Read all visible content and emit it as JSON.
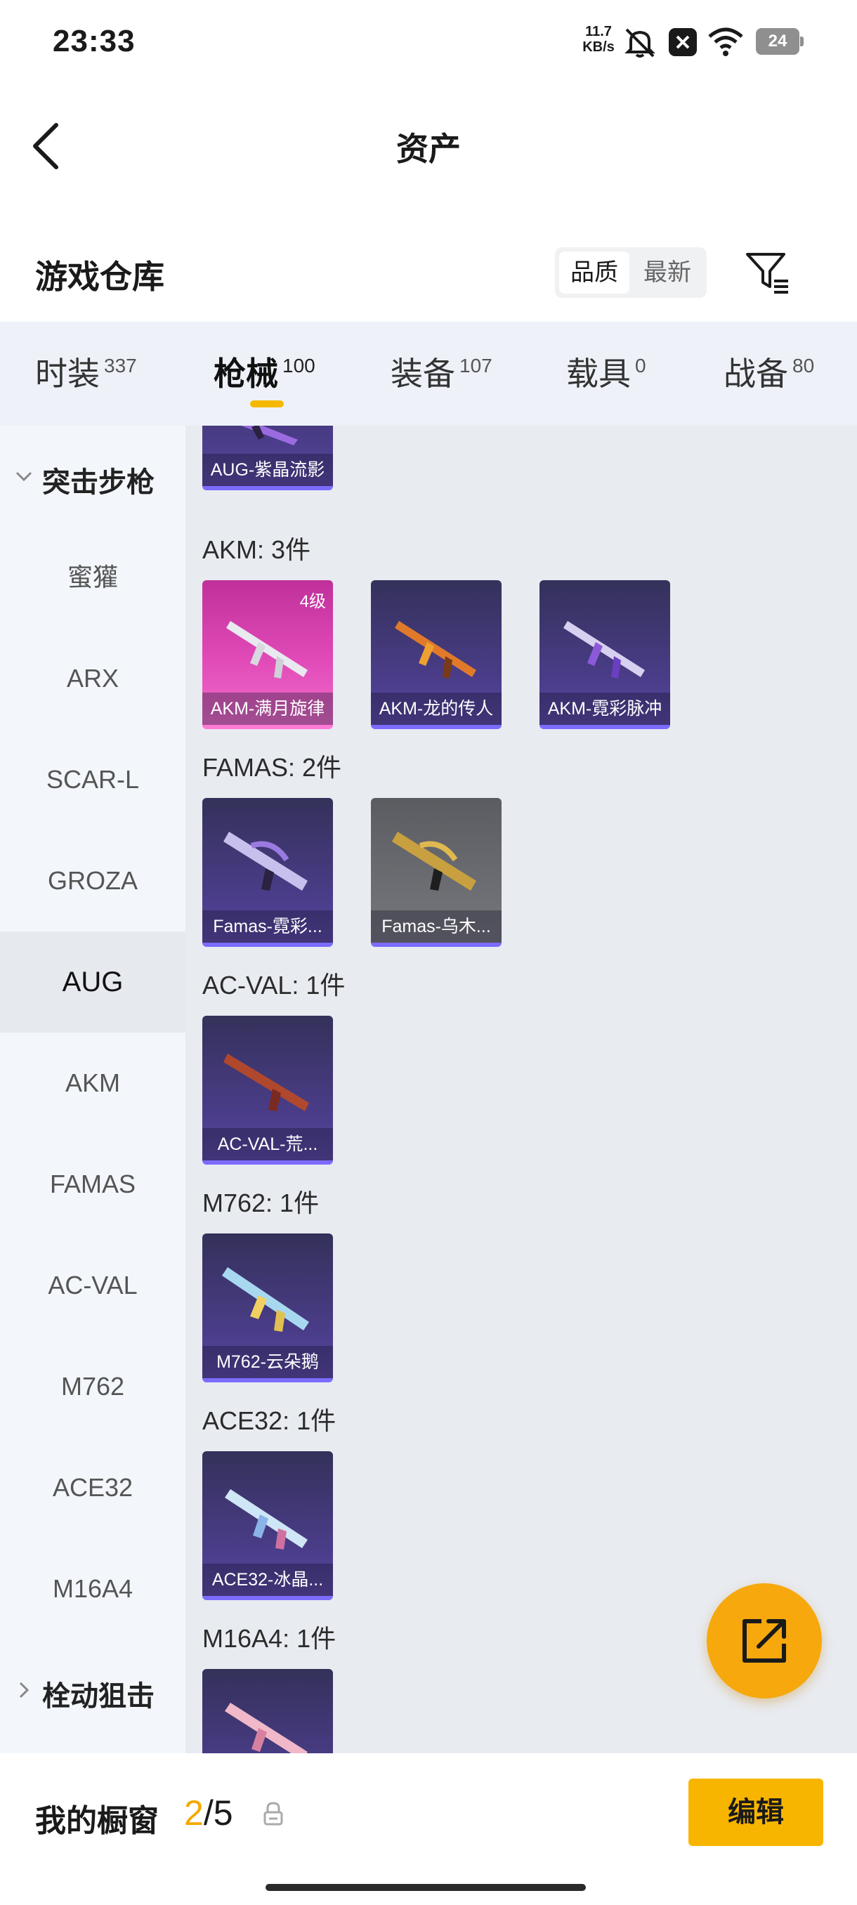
{
  "status_bar": {
    "time": "23:33",
    "net_speed_value": "11.7",
    "net_speed_unit": "KB/s",
    "battery": "24"
  },
  "header": {
    "title": "资产"
  },
  "warehouse": {
    "title": "游戏仓库",
    "sort_options": [
      "品质",
      "最新"
    ],
    "sort_selected": "品质"
  },
  "category_tabs": [
    {
      "label": "时装",
      "count": "337"
    },
    {
      "label": "枪械",
      "count": "100"
    },
    {
      "label": "装备",
      "count": "107"
    },
    {
      "label": "载具",
      "count": "0"
    },
    {
      "label": "战备",
      "count": "80"
    }
  ],
  "active_tab": "枪械",
  "sidebar": {
    "groups": [
      {
        "label": "突击步枪",
        "expanded": true
      },
      {
        "label": "栓动狙击",
        "expanded": false
      }
    ],
    "items": [
      "蜜獾",
      "ARX",
      "SCAR-L",
      "GROZA",
      "AUG",
      "AKM",
      "FAMAS",
      "AC-VAL",
      "M762",
      "ACE32",
      "M16A4"
    ],
    "active_item": "AUG"
  },
  "sections": [
    {
      "title": "AKM: 3件",
      "cards": [
        {
          "name": "AKM-满月旋律",
          "level": "4级",
          "rarity": "legendary"
        },
        {
          "name": "AKM-龙的传人",
          "rarity": "epic"
        },
        {
          "name": "AKM-霓彩脉冲",
          "rarity": "epic"
        }
      ]
    },
    {
      "title": "FAMAS: 2件",
      "cards": [
        {
          "name": "Famas-霓彩...",
          "rarity": "epic"
        },
        {
          "name": "Famas-乌木...",
          "rarity": "common"
        }
      ]
    },
    {
      "title": "AC-VAL: 1件",
      "cards": [
        {
          "name": "AC-VAL-荒...",
          "rarity": "epic"
        }
      ]
    },
    {
      "title": "M762: 1件",
      "cards": [
        {
          "name": "M762-云朵鹅",
          "rarity": "epic"
        }
      ]
    },
    {
      "title": "ACE32: 1件",
      "cards": [
        {
          "name": "ACE32-冰晶...",
          "rarity": "epic"
        }
      ]
    },
    {
      "title": "M16A4: 1件",
      "cards": []
    }
  ],
  "partial_top_card": {
    "name": "AUG-紫晶流影"
  },
  "bottom_bar": {
    "label": "我的橱窗",
    "current": "2",
    "separator": "/",
    "total": "5",
    "edit_label": "编辑"
  },
  "colors": {
    "accent": "#f8b500",
    "fab": "#f6a80d",
    "card_epic": "#4b3d8a",
    "card_legendary": "#e14ab8",
    "card_common": "#6c6d72"
  }
}
